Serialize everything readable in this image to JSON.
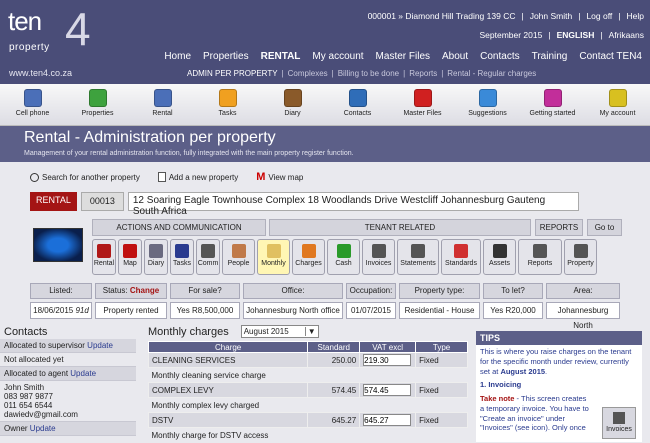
{
  "header": {
    "logo_ten": "ten",
    "logo_four": "4",
    "logo_property": "property",
    "website": "www.ten4.co.za",
    "account": "000001 » Diamond Hill Trading 139 CC",
    "user": "John Smith",
    "logoff": "Log off",
    "help": "Help",
    "period": "September 2015",
    "lang_active": "ENGLISH",
    "lang_other": "Afrikaans",
    "nav": [
      "Home",
      "Properties",
      "RENTAL",
      "My account",
      "Master Files",
      "About",
      "Contacts",
      "Training",
      "Contact TEN4"
    ],
    "subnav": {
      "current": "ADMIN PER PROPERTY",
      "items": [
        "Complexes",
        "Billing to be done",
        "Reports",
        "Rental - Regular charges"
      ]
    }
  },
  "iconbar": [
    {
      "label": "Cell phone",
      "color": "#4b6fb8"
    },
    {
      "label": "Properties",
      "color": "#3ea23e"
    },
    {
      "label": "Rental",
      "color": "#4b6fb8"
    },
    {
      "label": "Tasks",
      "color": "#f0a020"
    },
    {
      "label": "Diary",
      "color": "#8a5a2a"
    },
    {
      "label": "Contacts",
      "color": "#2f6db8"
    },
    {
      "label": "Master Files",
      "color": "#d02020"
    },
    {
      "label": "Suggestions",
      "color": "#3a8ad8"
    },
    {
      "label": "Getting started",
      "color": "#c22e9a"
    },
    {
      "label": "My account",
      "color": "#d8c020"
    }
  ],
  "page": {
    "title": "Rental - Administration per property",
    "subtitle": "Management of your rental administration function, fully integrated with the main property register function."
  },
  "actions": {
    "search": "Search for another property",
    "add": "Add a new property",
    "map_letter": "M",
    "map": "View map"
  },
  "property": {
    "type": "RENTAL",
    "ref": "00013",
    "address": "12 Soaring Eagle Townhouse Complex 18 Woodlands Drive Westcliff Johannesburg Gauteng South Africa"
  },
  "sections": {
    "actions": "ACTIONS AND COMMUNICATION",
    "tenant": "TENANT RELATED",
    "reports": "REPORTS",
    "goto": "Go to"
  },
  "buttons": [
    {
      "label": "Rental",
      "color": "#b01818"
    },
    {
      "label": "Map",
      "color": "#c01010"
    },
    {
      "label": "Diary",
      "color": "#6a6a80"
    },
    {
      "label": "Tasks",
      "color": "#2a3b8f"
    },
    {
      "label": "Comm",
      "color": "#555"
    },
    {
      "label": "People",
      "color": "#c07a4a"
    },
    {
      "label": "Monthly",
      "color": "#e0c060"
    },
    {
      "label": "Charges",
      "color": "#e07820"
    },
    {
      "label": "Cash",
      "color": "#2a9a2a"
    },
    {
      "label": "Invoices",
      "color": "#555"
    },
    {
      "label": "Statements",
      "color": "#555"
    },
    {
      "label": "Standards",
      "color": "#d03030"
    },
    {
      "label": "Assets",
      "color": "#333"
    },
    {
      "label": "Reports",
      "color": "#555"
    },
    {
      "label": "Property",
      "color": "#555"
    }
  ],
  "info": {
    "listed_label": "Listed:",
    "listed": "18/06/2015",
    "listed_days": "91d",
    "status_label": "Status:",
    "status_change": "Change",
    "status": "Property rented",
    "sale_label": "For sale?",
    "sale": "Yes  R8,500,000",
    "office_label": "Office:",
    "office": "Johannesburg North office",
    "occ_label": "Occupation:",
    "occ": "01/07/2015",
    "ptype_label": "Property type:",
    "ptype": "Residential - House",
    "let_label": "To let?",
    "let": "Yes  R20,000",
    "area_label": "Area:",
    "area": "Johannesburg North"
  },
  "contacts": {
    "title": "Contacts",
    "supervisor": "Allocated to supervisor",
    "agent_none": "Not allocated yet",
    "agent": "Allocated to agent",
    "update": "Update",
    "name": "John Smith",
    "phone1": "083 987 9877",
    "phone2": "011 654 6544",
    "email": "dawiedv@gmail.com",
    "owner": "Owner"
  },
  "charges": {
    "title": "Monthly charges",
    "month": "August 2015",
    "columns": [
      "Charge",
      "Standard",
      "VAT excl",
      "Type"
    ],
    "rows": [
      {
        "charge": "CLEANING SERVICES",
        "standard": "250.00",
        "vat": "219.30",
        "type": "Fixed",
        "desc": "Monthly cleaning service charge"
      },
      {
        "charge": "COMPLEX LEVY",
        "standard": "574.45",
        "vat": "574.45",
        "type": "Fixed",
        "desc": "Monthly complex levy charged"
      },
      {
        "charge": "DSTV",
        "standard": "645.27",
        "vat": "645.27",
        "type": "Fixed",
        "desc": "Monthly charge for DSTV access"
      }
    ]
  },
  "tips": {
    "title": "TIPS",
    "intro": "This is where you raise charges on the tenant for the specific month under review, currently set at",
    "intro_month": "August 2015",
    "heading": "1. Invoicing",
    "note_label": "Take note",
    "note": "- This screen creates a temporary invoice. You have to \"Create an invoice\" under \"Invoices\" (see icon). Only once",
    "invoices": "Invoices"
  }
}
